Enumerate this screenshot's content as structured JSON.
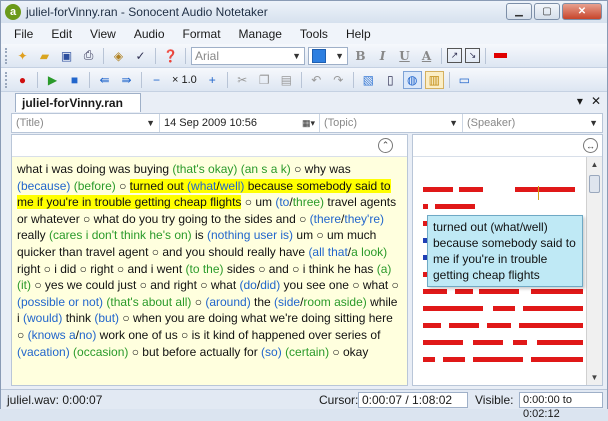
{
  "window": {
    "title": "juliel-forVinny.ran - Sonocent Audio Notetaker",
    "app_icon_letter": "a",
    "controls": [
      "minimize",
      "maximize",
      "close"
    ]
  },
  "menu": [
    "File",
    "Edit",
    "View",
    "Audio",
    "Format",
    "Manage",
    "Tools",
    "Help"
  ],
  "toolbar": {
    "font_name": "Arial",
    "bold": "B",
    "italic": "I",
    "underline": "U",
    "text_color": "A",
    "zoom": "× 1.0",
    "text_color_hex": "#2e7fe0",
    "highlight_color_hex": "#e00000"
  },
  "tab": {
    "name": "juliel-forVinny.ran"
  },
  "fields": {
    "title_placeholder": "(Title)",
    "date": "14 Sep 2009 10:56",
    "topic_placeholder": "(Topic)",
    "speaker_placeholder": "(Speaker)"
  },
  "transcript": [
    {
      "t": "what i was doing was buying "
    },
    {
      "t": "(that's okay)",
      "c": "g"
    },
    {
      "t": " "
    },
    {
      "t": "(an s a k)",
      "c": "g"
    },
    {
      "t": " ○ why was "
    },
    {
      "t": "(because)",
      "c": "b"
    },
    {
      "t": " "
    },
    {
      "t": "(before)",
      "c": "g"
    },
    {
      "t": " ○ "
    },
    {
      "t": "turned out ",
      "h": true
    },
    {
      "t": "(what",
      "h": true,
      "c": "b"
    },
    {
      "t": "/",
      "h": true
    },
    {
      "t": "well)",
      "h": true,
      "c": "b"
    },
    {
      "t": " because somebody said to me if you're in trouble getting cheap flights",
      "h": true
    },
    {
      "t": " ○ um "
    },
    {
      "t": "(to",
      "c": "b"
    },
    {
      "t": "/"
    },
    {
      "t": "three)",
      "c": "g"
    },
    {
      "t": " travel agents or whatever ○ what do you try going to the sides and ○ "
    },
    {
      "t": "(there",
      "c": "b"
    },
    {
      "t": "/"
    },
    {
      "t": "they're)",
      "c": "b"
    },
    {
      "t": " really "
    },
    {
      "t": "(cares i don't think he's on)",
      "c": "g"
    },
    {
      "t": " is "
    },
    {
      "t": "(nothing user is)",
      "c": "b"
    },
    {
      "t": " um ○ um much quicker than travel agent ○ and you should really have "
    },
    {
      "t": "(all that",
      "c": "b"
    },
    {
      "t": "/"
    },
    {
      "t": "a look)",
      "c": "g"
    },
    {
      "t": " right ○ i did ○ right ○ and i went "
    },
    {
      "t": "(to the)",
      "c": "g"
    },
    {
      "t": " sides ○ and ○ i think he has "
    },
    {
      "t": "(a)",
      "c": "g"
    },
    {
      "t": " "
    },
    {
      "t": "(it)",
      "c": "g"
    },
    {
      "t": " ○ yes we could just ○ and right ○ what "
    },
    {
      "t": "(do",
      "c": "b"
    },
    {
      "t": "/"
    },
    {
      "t": "did)",
      "c": "b"
    },
    {
      "t": " you see one ○ what ○ "
    },
    {
      "t": "(possible or not)",
      "c": "b"
    },
    {
      "t": " "
    },
    {
      "t": "(that's about all)",
      "c": "g"
    },
    {
      "t": " ○ "
    },
    {
      "t": "(around)",
      "c": "b"
    },
    {
      "t": " the "
    },
    {
      "t": "(side",
      "c": "b"
    },
    {
      "t": "/"
    },
    {
      "t": "room aside)",
      "c": "g"
    },
    {
      "t": " while i "
    },
    {
      "t": "(would)",
      "c": "b"
    },
    {
      "t": " think "
    },
    {
      "t": "(but)",
      "c": "b"
    },
    {
      "t": " ○ when you are doing what we're doing sitting here ○ "
    },
    {
      "t": "(knows",
      "c": "b"
    },
    {
      "t": " "
    },
    {
      "t": "a",
      "c": "b"
    },
    {
      "t": "/"
    },
    {
      "t": "no)",
      "c": "b"
    },
    {
      "t": " work one of us ○ is it kind of happened over series of "
    },
    {
      "t": "(vacation)",
      "c": "b"
    },
    {
      "t": " "
    },
    {
      "t": "(occasion)",
      "c": "g"
    },
    {
      "t": " ○ but before actually for "
    },
    {
      "t": "(so)",
      "c": "b"
    },
    {
      "t": " "
    },
    {
      "t": "(certain)",
      "c": "g"
    },
    {
      "t": " ○ okay"
    }
  ],
  "tooltip": "turned out (what/well) because somebody said to me if you're in trouble getting cheap flights",
  "status": {
    "file_position": "juliel.wav: 0:00:07",
    "cursor_label": "Cursor:",
    "cursor_value": "0:00:07 / 1:08:02",
    "visible_label": "Visible:",
    "visible_value": "0:00:00 to 0:02:12"
  },
  "colors": {
    "bar_red": "#e01818",
    "bar_blue": "#1f3fb5",
    "highlight_yellow": "#ffff00",
    "alt_green": "#2a9a2a",
    "alt_blue": "#2266cc",
    "transcript_bg": "#ffffde"
  }
}
